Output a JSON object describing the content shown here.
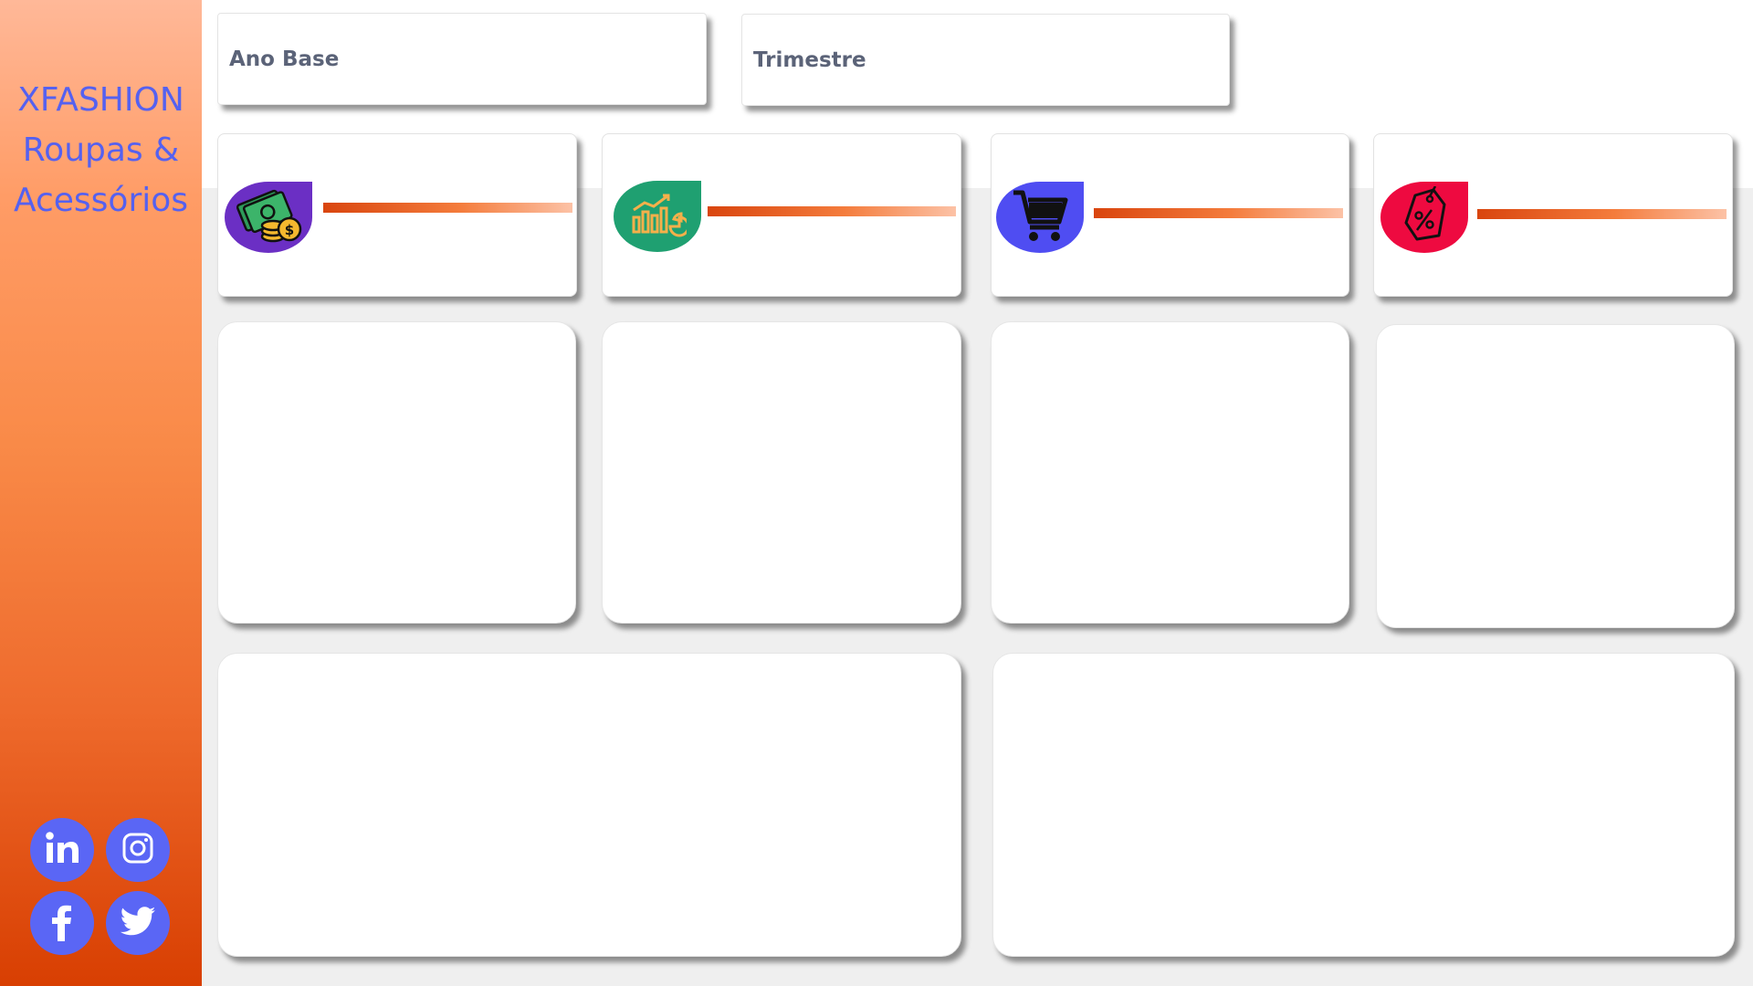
{
  "brand": {
    "line1": "XFASHION",
    "line2": "Roupas &",
    "line3": "Acessórios"
  },
  "colors": {
    "accent": "#5a66f5",
    "sidebar_top": "#ffb898",
    "sidebar_bottom": "#d83f02",
    "kpi_bar": "#e8602a",
    "revenue_icon_bg": "#6b2fc4",
    "chart_icon_bg": "#1fa071",
    "cart_icon_bg": "#4f4df2",
    "discount_icon_bg": "#ee0a40"
  },
  "filters": {
    "year_label": "Ano Base",
    "quarter_label": "Trimestre"
  },
  "kpis": [
    {
      "icon": "money-icon"
    },
    {
      "icon": "chart-growth-icon"
    },
    {
      "icon": "cart-icon"
    },
    {
      "icon": "discount-tag-icon"
    }
  ],
  "social": [
    "linkedin-icon",
    "instagram-icon",
    "facebook-icon",
    "twitter-icon"
  ]
}
